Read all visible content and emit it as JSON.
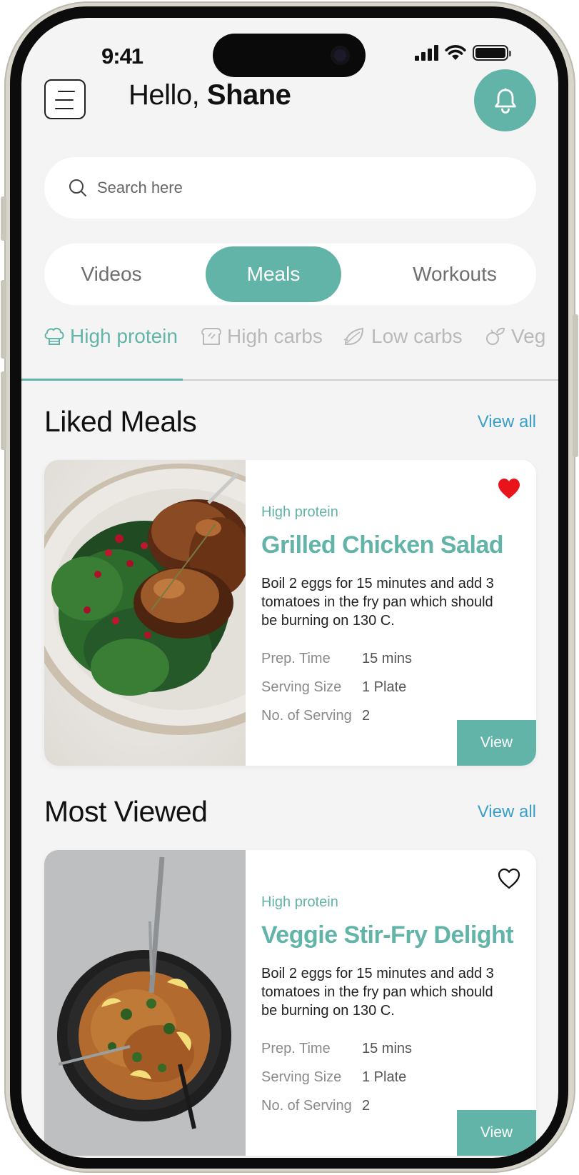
{
  "status_bar": {
    "time": "9:41"
  },
  "header": {
    "greeting_prefix": "Hello, ",
    "user_name": "Shane"
  },
  "search": {
    "placeholder": "Search here"
  },
  "content_tabs": [
    {
      "label": "Videos",
      "active": false
    },
    {
      "label": "Meals",
      "active": true
    },
    {
      "label": "Workouts",
      "active": false
    }
  ],
  "category_tabs": [
    {
      "label": "High protein",
      "icon": "chef-hat-icon",
      "active": true
    },
    {
      "label": "High carbs",
      "icon": "bread-icon",
      "active": false
    },
    {
      "label": "Low carbs",
      "icon": "leaf-icon",
      "active": false
    },
    {
      "label": "Veg",
      "icon": "vegetables-icon",
      "active": false
    }
  ],
  "sections": {
    "liked": {
      "title": "Liked Meals",
      "view_all": "View all",
      "card": {
        "tag": "High protein",
        "title": "Grilled Chicken Salad",
        "description": "Boil 2 eggs for 15 minutes and add 3 tomatoes in the fry pan which should be burning on 130 C.",
        "stats": [
          {
            "label": "Prep. Time",
            "value": "15 mins"
          },
          {
            "label": "Serving Size",
            "value": "1 Plate"
          },
          {
            "label": "No. of Serving",
            "value": "2"
          }
        ],
        "liked": true,
        "button_label": "View"
      }
    },
    "most_viewed": {
      "title": "Most Viewed",
      "view_all": "View all",
      "card": {
        "tag": "High protein",
        "title": "Veggie Stir-Fry Delight",
        "description": "Boil 2 eggs for 15 minutes and add 3 tomatoes in the fry pan which should be burning on 130 C.",
        "stats": [
          {
            "label": "Prep. Time",
            "value": "15 mins"
          },
          {
            "label": "Serving Size",
            "value": "1 Plate"
          },
          {
            "label": "No. of Serving",
            "value": "2"
          }
        ],
        "liked": false,
        "button_label": "View"
      }
    }
  },
  "colors": {
    "accent": "#63b4a8",
    "link": "#3ba0c9",
    "heart": "#e8131b",
    "background": "#f4f4f4"
  }
}
